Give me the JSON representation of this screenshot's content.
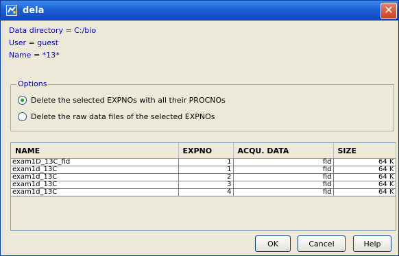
{
  "window": {
    "title": "dela"
  },
  "info": {
    "data_directory": "Data directory = C:/bio",
    "user": "User = guest",
    "name": "Name = *13*"
  },
  "options": {
    "legend": "Options",
    "items": [
      {
        "label": "Delete the selected EXPNOs with all their PROCNOs",
        "selected": true
      },
      {
        "label": "Delete the raw data files of the selected EXPNOs",
        "selected": false
      }
    ]
  },
  "table": {
    "columns": [
      "NAME",
      "EXPNO",
      "ACQU. DATA",
      "SIZE"
    ],
    "rows": [
      {
        "name": "exam1D_13C_fid",
        "expno": "1",
        "acqu": "fid",
        "size": "64 K"
      },
      {
        "name": "exam1d_13C",
        "expno": "1",
        "acqu": "fid",
        "size": "64 K"
      },
      {
        "name": "exam1d_13C",
        "expno": "2",
        "acqu": "fid",
        "size": "64 K"
      },
      {
        "name": "exam1d_13C",
        "expno": "3",
        "acqu": "fid",
        "size": "64 K"
      },
      {
        "name": "exam1d_13C",
        "expno": "4",
        "acqu": "fid",
        "size": "64 K"
      }
    ]
  },
  "buttons": {
    "ok": "OK",
    "cancel": "Cancel",
    "help": "Help"
  },
  "colors": {
    "title_bar": "#1f5fd6",
    "info_text": "#0000cc",
    "close": "#c8401f"
  },
  "icons": {
    "app": "app-icon",
    "close": "close-icon"
  }
}
